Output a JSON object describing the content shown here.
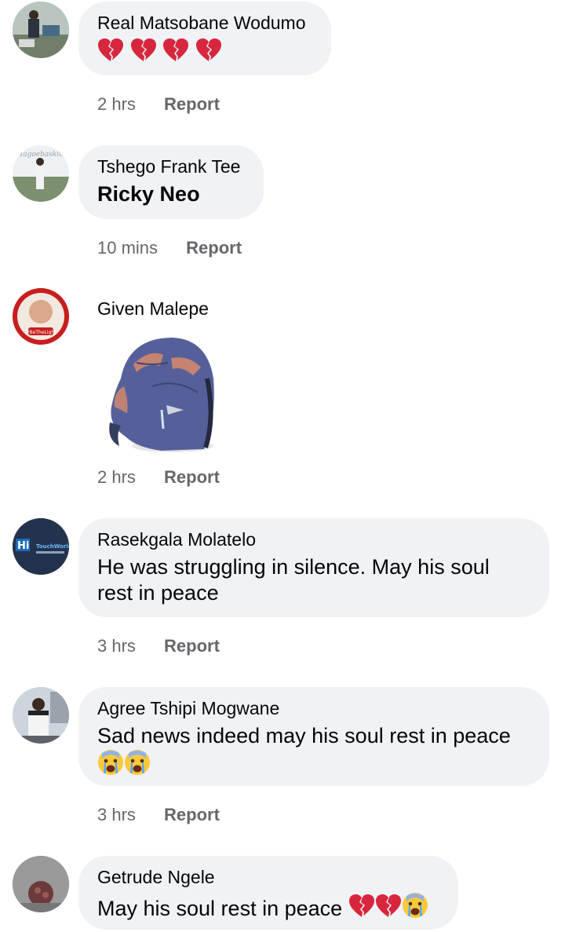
{
  "comments": [
    {
      "author": "Real Matsobane Wodumo",
      "time": "2 hrs",
      "report": "Report",
      "emoji": [
        "broken-heart-icon",
        "broken-heart-icon",
        "broken-heart-icon",
        "broken-heart-icon"
      ]
    },
    {
      "author": "Tshego Frank Tee",
      "text": "Ricky Neo",
      "time": "10 mins",
      "report": "Report",
      "avatar_text": "Magoebaskloof"
    },
    {
      "author": "Given Malepe",
      "time": "2 hrs",
      "report": "Report",
      "avatar_text": "#BeTheLight",
      "sticker": "crying-rhino-sticker"
    },
    {
      "author": "Rasekgala Molatelo",
      "text": "He was struggling in silence. May his soul rest in peace",
      "time": "3 hrs",
      "report": "Report",
      "avatar_text": "TouchWorld"
    },
    {
      "author": "Agree Tshipi Mogwane",
      "text": "Sad news indeed may his soul rest in peace",
      "time": "3 hrs",
      "report": "Report",
      "emoji": [
        "crying-face-icon",
        "crying-face-icon"
      ]
    },
    {
      "author": "Getrude Ngele",
      "text": "May his soul rest in peace",
      "emoji": [
        "broken-heart-icon",
        "broken-heart-icon",
        "crying-face-icon"
      ]
    }
  ],
  "colors": {
    "bubble": "#f0f2f5",
    "meta": "#65676b",
    "text": "#050505",
    "heart": "#d7263d"
  }
}
